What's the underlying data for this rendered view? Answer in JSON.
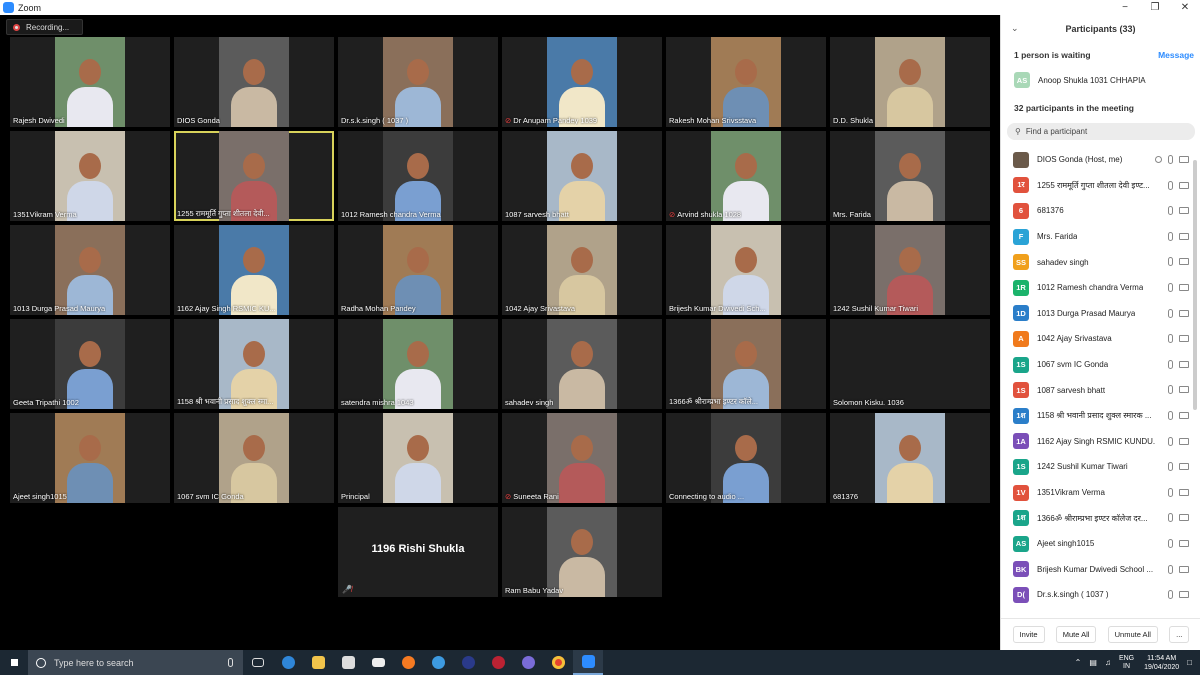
{
  "window": {
    "title": "Zoom",
    "minimize": "−",
    "maximize": "❐",
    "close": "✕"
  },
  "recording": {
    "label": "Recording..."
  },
  "tiles": [
    {
      "name": "Rajesh Dwivedi",
      "muted": false
    },
    {
      "name": "DIOS Gonda",
      "muted": false
    },
    {
      "name": "Dr.s.k.singh ( 1037 )",
      "muted": false
    },
    {
      "name": "Dr Anupam Pandey 1039",
      "muted": true
    },
    {
      "name": "Rakesh Mohan Srivsstava",
      "muted": false
    },
    {
      "name": "D.D. Shukla",
      "muted": false
    },
    {
      "name": "1351Vikram Verma",
      "muted": false
    },
    {
      "name": "1255 राममूर्ति गुप्ता  शीतला देवी...",
      "muted": false
    },
    {
      "name": "1012 Ramesh chandra Verma",
      "muted": false
    },
    {
      "name": "1087 sarvesh bhatt",
      "muted": false
    },
    {
      "name": "Arvind shukla 1028",
      "muted": true
    },
    {
      "name": "Mrs. Farida",
      "muted": false
    },
    {
      "name": "1013 Durga Prasad Maurya",
      "muted": false
    },
    {
      "name": "1162 Ajay Singh RSMIC KU...",
      "muted": false
    },
    {
      "name": "Radha Mohan Pandey",
      "muted": false
    },
    {
      "name": "1042 Ajay Srivastava",
      "muted": false
    },
    {
      "name": "Brijesh Kumar Dwivedi  Sch...",
      "muted": false
    },
    {
      "name": "1242 Sushil Kumar Tiwari",
      "muted": false
    },
    {
      "name": "Geeta Tripathi  1002",
      "muted": false
    },
    {
      "name": "1158 श्री भवानी प्रसाद शुक्ल स्मा...",
      "muted": false
    },
    {
      "name": "satendra mishra 1043",
      "muted": false
    },
    {
      "name": "sahadev singh",
      "muted": false
    },
    {
      "name": "1366ॐ श्रीराम्प्रभा इण्टर कॉले...",
      "muted": false
    },
    {
      "name": "Solomon Kisku. 1036",
      "muted": false
    },
    {
      "name": "Ajeet singh1015",
      "muted": false
    },
    {
      "name": "1067 svm IC Gonda",
      "muted": false
    },
    {
      "name": "Principal",
      "muted": false
    },
    {
      "name": "Suneeta Rani",
      "muted": true
    },
    {
      "name": "Connecting to audio ...",
      "muted": false
    },
    {
      "name": "681376",
      "muted": false
    },
    {
      "name": "1196 Rishi Shukla",
      "muted": true
    },
    {
      "name": "Ram Babu Yadav",
      "muted": false
    }
  ],
  "panel": {
    "title": "Participants (33)",
    "collapse_icon": "⌄",
    "waiting": "1 person is waiting",
    "message": "Message",
    "waiting_person": {
      "initials": "AS",
      "name": "Anoop Shukla 1031 CHHAPIA",
      "color": "#a9d8b7"
    },
    "in_meeting": "32 participants in the meeting",
    "search_placeholder": "Find a participant",
    "participants": [
      {
        "initials": "",
        "name": "DIOS Gonda (Host, me)",
        "color": "#6b5a4a"
      },
      {
        "initials": "1र",
        "name": "1255 राममूर्ति गुप्ता  शीतला देवी इण्ट...",
        "color": "#e1523d"
      },
      {
        "initials": "6",
        "name": "681376",
        "color": "#e1523d"
      },
      {
        "initials": "F",
        "name": "Mrs. Farida",
        "color": "#2aa3d6"
      },
      {
        "initials": "SS",
        "name": "sahadev singh",
        "color": "#f0a01c"
      },
      {
        "initials": "1R",
        "name": "1012 Ramesh chandra Verma",
        "color": "#1bb36b"
      },
      {
        "initials": "1D",
        "name": "1013 Durga Prasad Maurya",
        "color": "#2b7ec9"
      },
      {
        "initials": "A",
        "name": "1042 Ajay Srivastava",
        "color": "#f07a1c"
      },
      {
        "initials": "1S",
        "name": "1067 svm IC Gonda",
        "color": "#1aa58a"
      },
      {
        "initials": "1S",
        "name": "1087 sarvesh bhatt",
        "color": "#e1523d"
      },
      {
        "initials": "1श",
        "name": "1158 श्री भवानी प्रसाद शुक्ल स्मारक ...",
        "color": "#2b7ec9"
      },
      {
        "initials": "1A",
        "name": "1162 Ajay Singh RSMIC KUNDU...",
        "color": "#7b4fb8"
      },
      {
        "initials": "1S",
        "name": "1242 Sushil Kumar Tiwari",
        "color": "#1aa58a"
      },
      {
        "initials": "1V",
        "name": "1351Vikram Verma",
        "color": "#e1523d"
      },
      {
        "initials": "1श",
        "name": "1366ॐ श्रीराम्प्रभा इण्टर कॉलेज दर...",
        "color": "#1aa58a"
      },
      {
        "initials": "AS",
        "name": "Ajeet singh1015",
        "color": "#1aa58a"
      },
      {
        "initials": "BK",
        "name": "Brijesh Kumar Dwivedi  School ...",
        "color": "#7b4fb8"
      },
      {
        "initials": "D(",
        "name": "Dr.s.k.singh ( 1037 )",
        "color": "#7b4fb8"
      }
    ],
    "buttons": {
      "invite": "Invite",
      "mute_all": "Mute All",
      "unmute_all": "Unmute All",
      "more": "..."
    }
  },
  "taskbar": {
    "search_placeholder": "Type here to search",
    "lang_top": "ENG",
    "lang_bottom": "IN",
    "time": "11:54 AM",
    "date": "19/04/2020"
  }
}
